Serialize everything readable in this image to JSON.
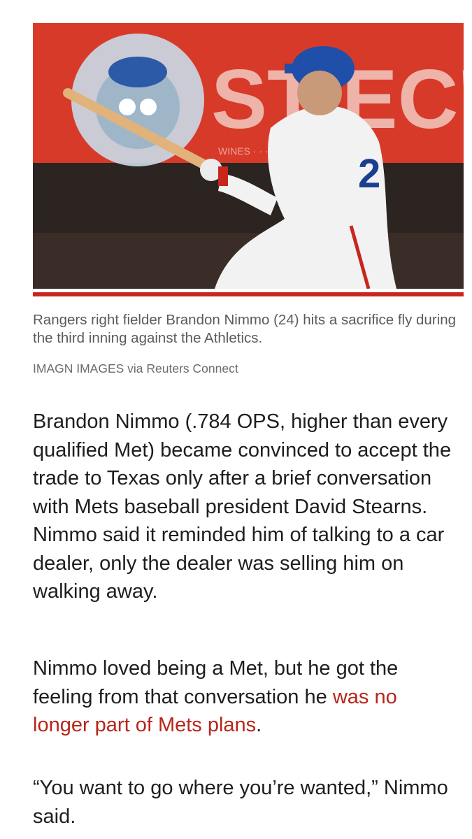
{
  "photo": {
    "description_icon": "baseball-player-photo",
    "sign_text": "ST  EC'S",
    "sign_subtext": "WINES · · · · · NER FOODS",
    "jersey_number": "2",
    "colors": {
      "sign_red": "#d83a2a",
      "accent": "#c8261d",
      "link": "#b8251a"
    }
  },
  "caption": "Rangers right fielder Brandon Nimmo (24) hits a sacrifice fly during the third inning against the Athletics.",
  "credit": "IMAGN IMAGES via Reuters Connect",
  "paragraphs": {
    "p1": "Brandon Nimmo (.784 OPS, higher than every qualified Met) became convinced to accept the trade to Texas only after a brief conversation with Mets baseball president David Stearns. Nimmo said it reminded him of talking to a car dealer, only the dealer was selling him on walking away.",
    "p2_before": "Nimmo loved being a Met, but he got the feeling from that conversation he ",
    "p2_link": "was no longer part of Mets plans",
    "p2_after": ".",
    "p3": "“You want to go where you’re wanted,” Nimmo said."
  }
}
